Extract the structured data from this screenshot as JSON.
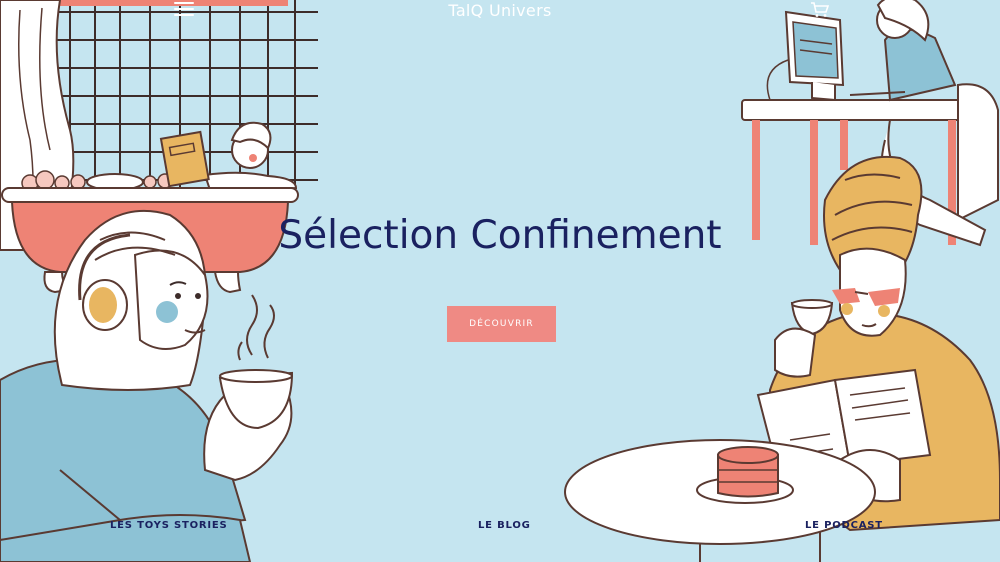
{
  "header": {
    "brand": "TalQ Univers",
    "menu_icon": "hamburger-menu-icon",
    "cart_icon": "shopping-cart-icon"
  },
  "hero": {
    "title": "Sélection Confinement",
    "cta_label": "DÉCOUVRIR"
  },
  "bottom_nav": {
    "items": [
      {
        "label": "LES TOYS STORIES"
      },
      {
        "label": "LE BLOG"
      },
      {
        "label": "LE PODCAST"
      }
    ]
  },
  "colors": {
    "background": "#c5e5f0",
    "title": "#1a2160",
    "button": "#ef8a84",
    "illustration_coral": "#ee8375",
    "illustration_mustard": "#e8b661",
    "illustration_blue": "#8dc2d5",
    "outline": "#5a3a32"
  }
}
